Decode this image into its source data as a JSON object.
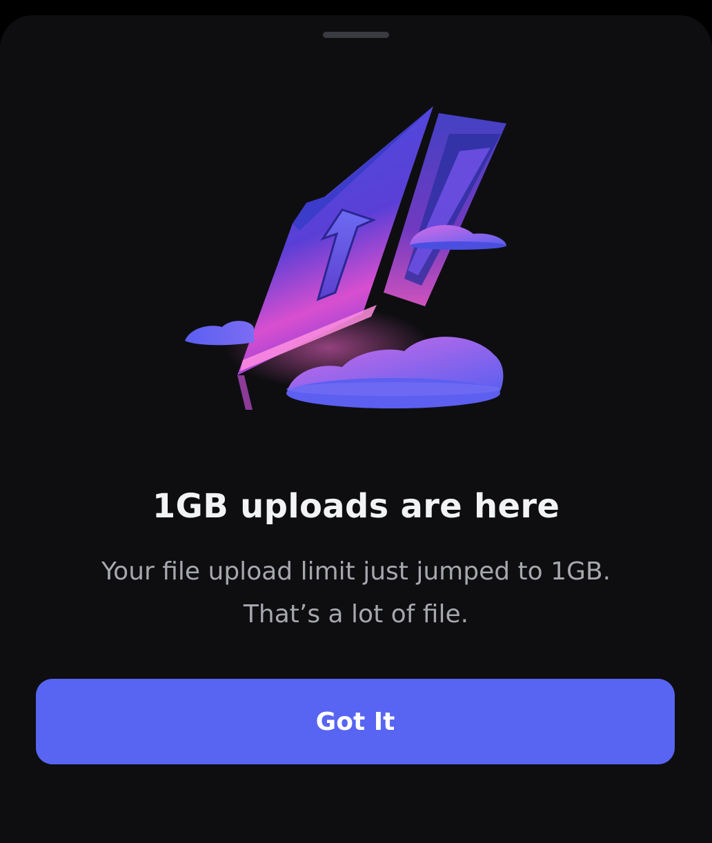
{
  "sheet": {
    "title": "1GB uploads are here",
    "description_lines": [
      "Your file upload limit just jumped to 1GB.",
      "That’s a lot of file."
    ],
    "primary_button_label": "Got It",
    "illustration_icon": "upload-folder-clouds-icon"
  },
  "colors": {
    "background": "#0e0e11",
    "accent": "#5865f2",
    "title_text": "#f2f3f5",
    "body_text": "#a6a8ad"
  }
}
